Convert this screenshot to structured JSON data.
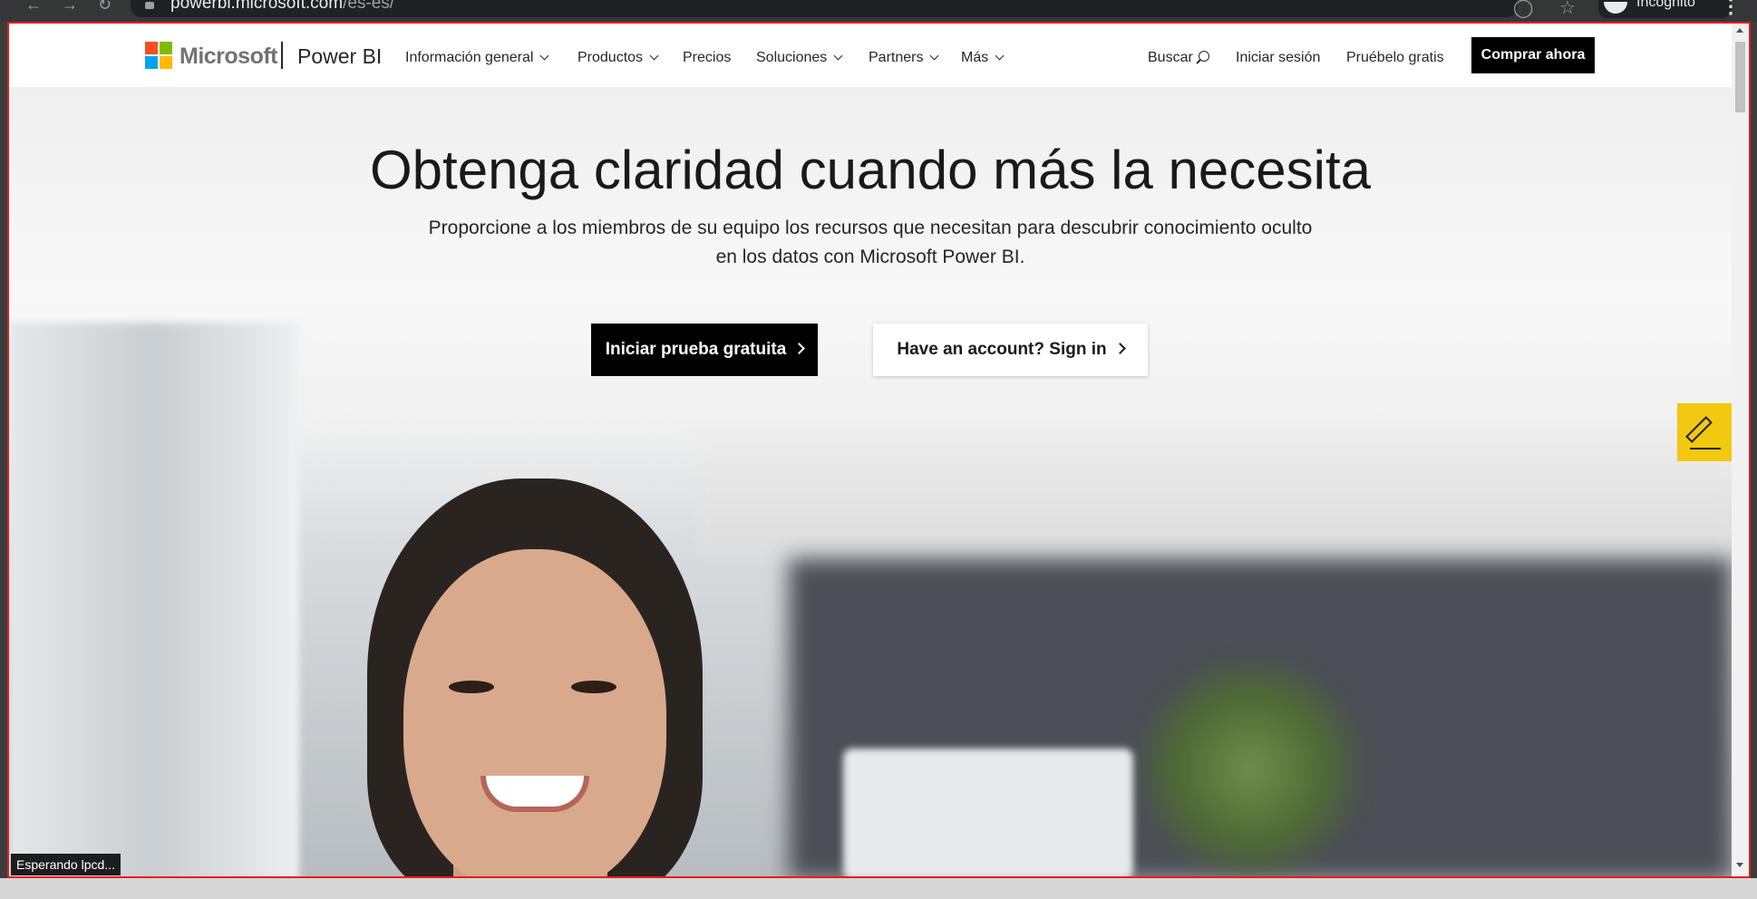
{
  "browser": {
    "url_host": "powerbi.microsoft.com",
    "url_path": "/es-es/",
    "incognito_label": "Incognito",
    "icons": [
      "back-icon",
      "forward-icon",
      "reload-icon",
      "lock-icon",
      "eye-off-icon",
      "star-icon",
      "incognito-icon",
      "menu-icon"
    ]
  },
  "header": {
    "ms_wordmark": "Microsoft",
    "brand": "Power BI",
    "nav": [
      {
        "label": "Información general",
        "has_dropdown": true
      },
      {
        "label": "Productos",
        "has_dropdown": true
      },
      {
        "label": "Precios",
        "has_dropdown": false
      },
      {
        "label": "Soluciones",
        "has_dropdown": true
      },
      {
        "label": "Partners",
        "has_dropdown": true
      },
      {
        "label": "Más",
        "has_dropdown": true
      }
    ],
    "search_label": "Buscar",
    "signin_label": "Iniciar sesión",
    "trial_label": "Pruébelo gratis",
    "buy_label": "Comprar ahora"
  },
  "hero": {
    "title": "Obtenga claridad cuando más la necesita",
    "subtitle_line1": "Proporcione a los miembros de su equipo los recursos que necesitan para descubrir conocimiento oculto",
    "subtitle_line2": "en los datos con Microsoft Power BI.",
    "primary_cta": "Iniciar prueba gratuita",
    "secondary_cta": "Have an account? Sign in"
  },
  "status_bar": "Esperando lpcd...",
  "colors": {
    "feedback_yellow": "#f2c811",
    "cta_black": "#000000",
    "frame_red": "#e0201c"
  }
}
